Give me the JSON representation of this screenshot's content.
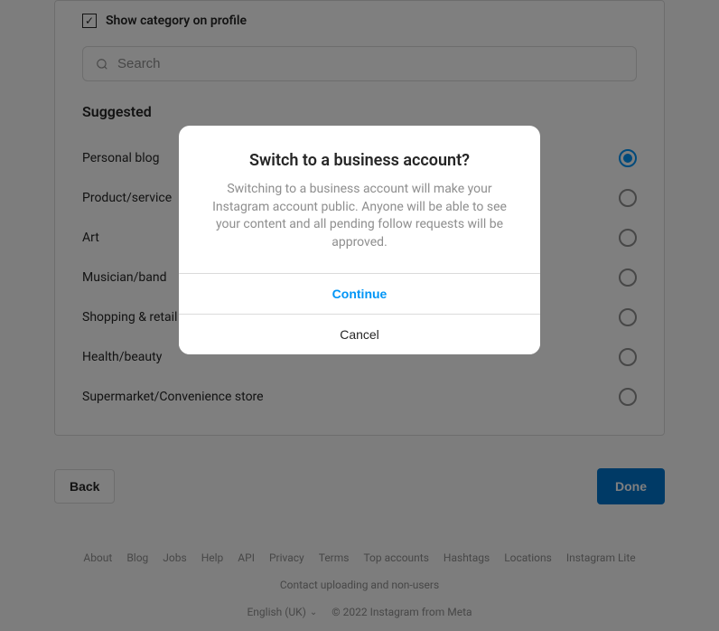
{
  "checkbox": {
    "label": "Show category on profile",
    "checked": true
  },
  "search": {
    "placeholder": "Search"
  },
  "suggested_header": "Suggested",
  "categories": [
    {
      "label": "Personal blog",
      "selected": true
    },
    {
      "label": "Product/service",
      "selected": false
    },
    {
      "label": "Art",
      "selected": false
    },
    {
      "label": "Musician/band",
      "selected": false
    },
    {
      "label": "Shopping & retail",
      "selected": false
    },
    {
      "label": "Health/beauty",
      "selected": false
    },
    {
      "label": "Supermarket/Convenience store",
      "selected": false
    }
  ],
  "buttons": {
    "back": "Back",
    "done": "Done"
  },
  "modal": {
    "title": "Switch to a business account?",
    "text": "Switching to a business account will make your Instagram account public. Anyone will be able to see your content and all pending follow requests will be approved.",
    "continue": "Continue",
    "cancel": "Cancel"
  },
  "footer": {
    "links": [
      "About",
      "Blog",
      "Jobs",
      "Help",
      "API",
      "Privacy",
      "Terms",
      "Top accounts",
      "Hashtags",
      "Locations",
      "Instagram Lite",
      "Contact uploading and non-users"
    ],
    "language": "English (UK)",
    "copyright": "© 2022 Instagram from Meta"
  }
}
